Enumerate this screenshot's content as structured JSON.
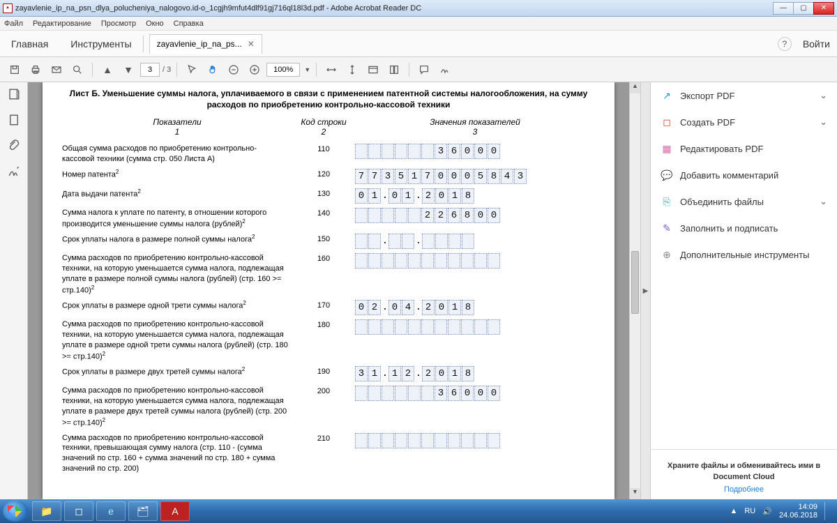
{
  "window": {
    "title": "zayavlenie_ip_na_psn_dlya_polucheniya_nalogovo.id-o_1cgjh9mfut4dlf91gj716ql18l3d.pdf - Adobe Acrobat Reader DC"
  },
  "appmenu": [
    "Файл",
    "Редактирование",
    "Просмотр",
    "Окно",
    "Справка"
  ],
  "ribbon": {
    "home": "Главная",
    "tools": "Инструменты",
    "tabname": "zayavlenie_ip_na_ps...",
    "login": "Войти"
  },
  "toolbar": {
    "page_cur": "3",
    "page_total": "/ 3",
    "zoom": "100%"
  },
  "doc": {
    "title": "Лист Б. Уменьшение суммы налога, уплачиваемого в связи с применением патентной системы налогообложения, на сумму расходов по приобретению контрольно-кассовой техники",
    "heads": {
      "a": "Показатели",
      "an": "1",
      "b": "Код строки",
      "bn": "2",
      "c": "Значения показателей",
      "cn": "3"
    },
    "rows": [
      {
        "label": "Общая сумма расходов по приобретению контрольно-кассовой техники (сумма стр. 050 Листа А)",
        "code": "110",
        "type": "num",
        "cells": [
          "",
          "",
          "",
          "",
          "",
          "",
          "3",
          "6",
          "0",
          "0",
          "0"
        ]
      },
      {
        "label": "Номер патента",
        "sup": "2",
        "code": "120",
        "type": "num",
        "cells": [
          "7",
          "7",
          "3",
          "5",
          "1",
          "7",
          "0",
          "0",
          "0",
          "5",
          "8",
          "4",
          "3"
        ]
      },
      {
        "label": "Дата выдачи патента",
        "sup": "2",
        "code": "130",
        "type": "date",
        "cells": [
          "0",
          "1",
          ".",
          "0",
          "1",
          ".",
          "2",
          "0",
          "1",
          "8"
        ]
      },
      {
        "label": "Сумма налога к уплате по патенту, в отношении которого производится уменьшение суммы налога (рублей)",
        "sup": "2",
        "code": "140",
        "type": "num",
        "cells": [
          "",
          "",
          "",
          "",
          "",
          "2",
          "2",
          "6",
          "8",
          "0",
          "0"
        ]
      },
      {
        "label": "Срок уплаты налога в размере полной суммы налога",
        "sup": "2",
        "code": "150",
        "type": "date",
        "cells": [
          "",
          "",
          ".",
          "",
          "",
          ".",
          "",
          "",
          "",
          ""
        ]
      },
      {
        "label": "Сумма расходов по приобретению контрольно-кассовой техники, на которую уменьшается сумма налога, подлежащая уплате в размере полной суммы налога (рублей) (стр. 160 >= стр.140)",
        "sup": "2",
        "code": "160",
        "type": "num",
        "cells": [
          "",
          "",
          "",
          "",
          "",
          "",
          "",
          "",
          "",
          "",
          ""
        ]
      },
      {
        "label": "Срок уплаты в размере одной трети суммы налога",
        "sup": "2",
        "code": "170",
        "type": "date",
        "cells": [
          "0",
          "2",
          ".",
          "0",
          "4",
          ".",
          "2",
          "0",
          "1",
          "8"
        ]
      },
      {
        "label": "Сумма расходов по приобретению контрольно-кассовой техники, на которую уменьшается сумма налога, подлежащая уплате в размере одной трети суммы налога (рублей) (стр. 180 >= стр.140)",
        "sup": "2",
        "code": "180",
        "type": "num",
        "cells": [
          "",
          "",
          "",
          "",
          "",
          "",
          "",
          "",
          "",
          "",
          ""
        ]
      },
      {
        "label": "Срок уплаты в размере двух третей суммы налога",
        "sup": "2",
        "code": "190",
        "type": "date",
        "cells": [
          "3",
          "1",
          ".",
          "1",
          "2",
          ".",
          "2",
          "0",
          "1",
          "8"
        ]
      },
      {
        "label": "Сумма расходов по приобретению контрольно-кассовой техники, на которую уменьшается сумма налога, подлежащая уплате в размере двух третей суммы налога (рублей) (стр. 200 >= стр.140)",
        "sup": "2",
        "code": "200",
        "type": "num",
        "cells": [
          "",
          "",
          "",
          "",
          "",
          "",
          "3",
          "6",
          "0",
          "0",
          "0"
        ]
      },
      {
        "label": "Сумма расходов по приобретению контрольно-кассовой техники, превышающая сумму налога (стр. 110 -  (сумма значений по стр. 160 + сумма значений по стр. 180 + сумма значений по стр. 200)",
        "code": "210",
        "type": "num",
        "cells": [
          "",
          "",
          "",
          "",
          "",
          "",
          "",
          "",
          "",
          "",
          ""
        ]
      }
    ]
  },
  "rightpanel": [
    {
      "icon": "↗",
      "color": "#1e9bd6",
      "label": "Экспорт PDF",
      "drop": true
    },
    {
      "icon": "◻",
      "color": "#d9443a",
      "label": "Создать PDF",
      "drop": true
    },
    {
      "icon": "▦",
      "color": "#d66aa5",
      "label": "Редактировать PDF"
    },
    {
      "icon": "💬",
      "color": "#e8a432",
      "label": "Добавить комментарий"
    },
    {
      "icon": "⎘",
      "color": "#3aa9c4",
      "label": "Объединить файлы",
      "drop": true
    },
    {
      "icon": "✎",
      "color": "#7a5fc7",
      "label": "Заполнить и подписать"
    },
    {
      "icon": "⊕",
      "color": "#888",
      "label": "Дополнительные инструменты"
    }
  ],
  "cloud": {
    "line": "Храните файлы и обменивайтесь ими в Document Cloud",
    "link": "Подробнее"
  },
  "taskbar": {
    "lang": "RU",
    "time": "14:09",
    "date": "24.06.2018"
  }
}
